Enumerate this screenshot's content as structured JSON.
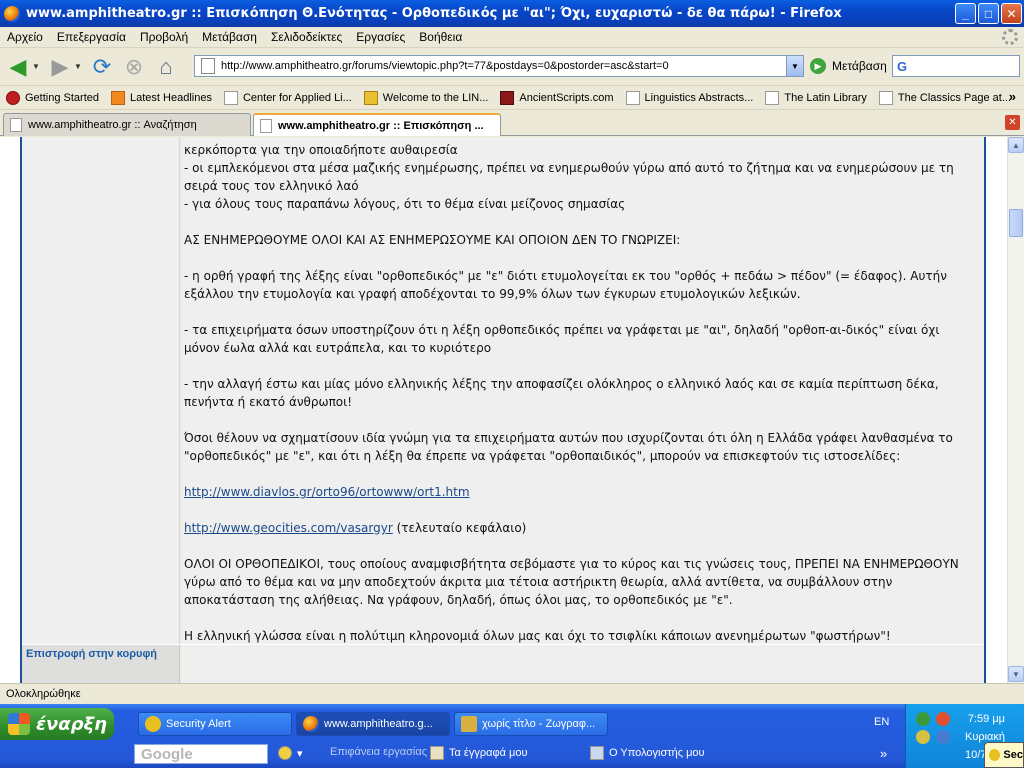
{
  "window": {
    "title": "www.amphitheatro.gr :: Επισκόπηση Θ.Ενότητας - Ορθοπεδικός με \"αι\"; Όχι, ευχαριστώ - δε θα πάρω! - Firefox",
    "buttons": {
      "minimize": "_",
      "maximize": "□",
      "close": "✕"
    }
  },
  "menu": [
    "Αρχείο",
    "Επεξεργασία",
    "Προβολή",
    "Μετάβαση",
    "Σελιδοδείκτες",
    "Εργασίες",
    "Βοήθεια"
  ],
  "navbar": {
    "url": "http://www.amphitheatro.gr/forums/viewtopic.php?t=77&postdays=0&postorder=asc&start=0",
    "go_label": "Μετάβαση",
    "search_placeholder": ""
  },
  "bookmarks": [
    "Getting Started",
    "Latest Headlines",
    "Center for Applied Li...",
    "Welcome to the LIN...",
    "AncientScripts.com",
    "Linguistics Abstracts...",
    "The Latin Library",
    "The Classics Page at..."
  ],
  "bookmarks_more": "»",
  "tabs": [
    {
      "label": "www.amphitheatro.gr :: Αναζήτηση",
      "active": false
    },
    {
      "label": "www.amphitheatro.gr :: Επισκόπηση ...",
      "active": true
    }
  ],
  "post": {
    "lines": [
      "κερκόπορτα για την οποιαδήποτε αυθαιρεσία",
      "- οι εμπλεκόμενοι στα μέσα μαζικής ενημέρωσης, πρέπει να ενημερωθούν γύρω από αυτό το ζήτημα και να ενημερώσουν με τη",
      "σειρά τους τον ελληνικό λαό",
      "- για όλους τους παραπάνω λόγους, ότι το θέμα είναι μείζονος σημασίας",
      "",
      "ΑΣ ΕΝΗΜΕΡΩΘΟΥΜΕ ΟΛΟΙ ΚΑΙ ΑΣ ΕΝΗΜΕΡΩΣΟΥΜΕ ΚΑΙ ΟΠΟΙΟΝ ΔΕΝ ΤΟ ΓΝΩΡΙΖΕΙ:",
      "",
      "- η ορθή γραφή της λέξης είναι \"ορθοπεδικός\" με \"ε\" διότι ετυμολογείται εκ του \"ορθός + πεδάω > πέδον\" (= έδαφος). Αυτήν",
      "εξάλλου την ετυμολογία και γραφή αποδέχονται το 99,9% όλων των έγκυρων ετυμολογικών λεξικών.",
      "",
      "- τα επιχειρήματα όσων υποστηρίζουν ότι η λέξη ορθοπεδικός πρέπει να γράφεται με \"αι\", δηλαδή \"ορθοπ-αι-δικός\" είναι όχι",
      "μόνον έωλα αλλά και ευτράπελα, και το κυριότερο",
      "",
      "- την αλλαγή έστω και μίας μόνο ελληνικής λέξης την αποφασίζει ολόκληρος ο ελληνικό λαός και σε καμία περίπτωση δέκα,",
      "πενήντα ή εκατό άνθρωποι!",
      "",
      "Όσοι θέλουν να σχηματίσουν ιδία γνώμη για τα επιχειρήματα αυτών που ισχυρίζονται ότι όλη η Ελλάδα γράφει λανθασμένα το",
      "\"ορθοπεδικός\" με \"ε\", και ότι η λέξη θα έπρεπε να γράφεται \"ορθοπαιδικός\", μπορούν να επισκεφτούν τις ιστοσελίδες:"
    ],
    "link1": "http://www.diavlos.gr/orto96/ortowww/ort1.htm",
    "link2": "http://www.geocities.com/vasargyr",
    "link2_suffix": " (τελευταίο κεφάλαιο)",
    "tail_lines": [
      "ΟΛΟΙ ΟΙ ΟΡΘΟΠΕΔΙΚΟΙ, τους οποίους αναμφισβήτητα σεβόμαστε για το κύρος και τις γνώσεις τους, ΠΡΕΠΕΙ ΝΑ ΕΝΗΜΕΡΩΘΟΥΝ",
      "γύρω από το θέμα και να μην αποδεχτούν άκριτα μια τέτοια αστήρικτη θεωρία, αλλά αντίθετα, να συμβάλλουν στην",
      "αποκατάσταση της αλήθειας. Να γράφουν, δηλαδή, όπως όλοι μας, το ορθοπεδικός με \"ε\".",
      "",
      "Η ελληνική γλώσσα είναι η πολύτιμη κληρονομιά όλων μας και όχι το τσιφλίκι κάποιων ανενημέρωτων \"φωστήρων\"!"
    ]
  },
  "back_to_top": "Επιστροφή στην κορυφή",
  "status": "Ολοκληρώθηκε",
  "taskbar": {
    "start": "έναρξη",
    "items": [
      "Security Alert",
      "www.amphitheatro.g...",
      "χωρίς τίτλο - Ζωγραφ..."
    ],
    "google": "Google",
    "quick": [
      "Επιφάνεια εργασίας",
      "Τα έγγραφά μου",
      "Ο Υπολογιστής μου"
    ],
    "quick_more": "»",
    "lang": "EN",
    "time": "7:59 μμ",
    "day": "Κυριακή",
    "date": "10/7",
    "popup": "Sec"
  }
}
